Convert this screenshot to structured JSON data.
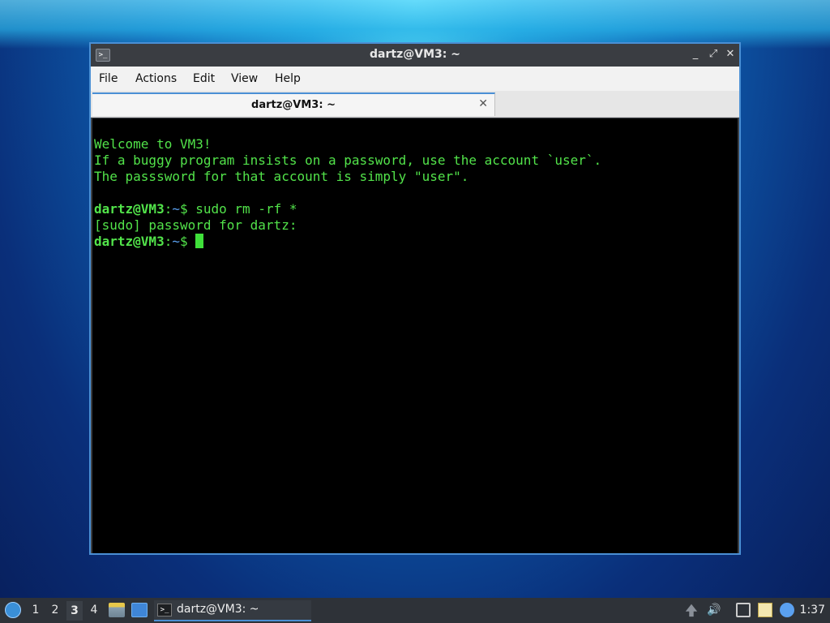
{
  "window": {
    "title": "dartz@VM3: ~",
    "icon": "terminal-icon",
    "controls": {
      "minimize": "_",
      "maximize": "⤢",
      "close": "✕"
    }
  },
  "menubar": {
    "items": [
      "File",
      "Actions",
      "Edit",
      "View",
      "Help"
    ]
  },
  "tab": {
    "label": "dartz@VM3: ~",
    "close": "✕"
  },
  "terminal": {
    "lines": [
      "Welcome to VM3!",
      "If a buggy program insists on a password, use the account `user`.",
      "The passsword for that account is simply \"user\".",
      ""
    ],
    "prompt_user": "dartz@VM3",
    "prompt_sep": ":",
    "prompt_path": "~",
    "prompt_sym": "$ ",
    "command1": "sudo rm -rf *",
    "sudo_line": "[sudo] password for dartz:"
  },
  "taskbar": {
    "start_icon": "distro-logo-icon",
    "workspaces": [
      "1",
      "2",
      "3",
      "4"
    ],
    "active_workspace": "3",
    "quick_launch": [
      "file-manager-icon",
      "show-desktop-icon"
    ],
    "task_label": "dartz@VM3: ~",
    "tray": [
      "update-arrow-icon",
      "volume-icon",
      "network-icon",
      "clipboard-icon",
      "notification-icon"
    ],
    "clock": "1:37"
  },
  "colors": {
    "accent": "#4a8fd4",
    "terminal_fg": "#52e34a",
    "terminal_bg": "#000000"
  }
}
